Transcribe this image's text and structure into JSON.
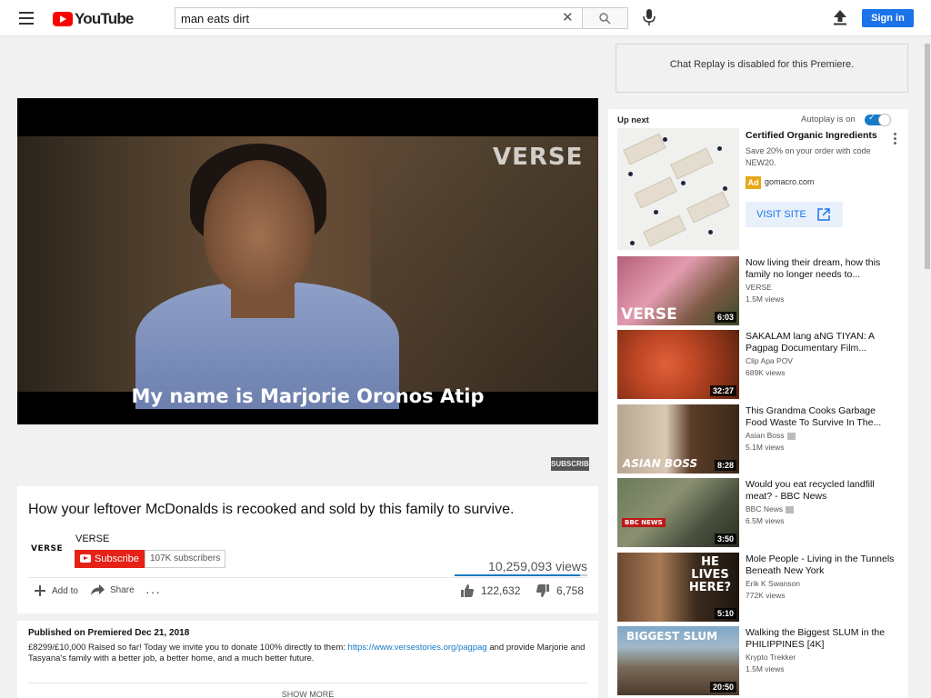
{
  "header": {
    "logo_text": "YouTube",
    "search_value": "man eats dirt",
    "clear_symbol": "✕",
    "signin_label": "Sign in",
    "icons": [
      "menu-icon",
      "search-icon",
      "mic-icon",
      "upload-icon"
    ]
  },
  "chat": {
    "message": "Chat Replay is disabled for this Premiere."
  },
  "player": {
    "watermark": "VERSE",
    "caption": "My name is Marjorie Oronos Atip",
    "subscribe_tag": "SUBSCRIBE"
  },
  "video_info": {
    "title": "How your leftover McDonalds is recooked and sold by this family to survive.",
    "channel_logo": "VERSE",
    "channel_name": "VERSE",
    "subscribe_label": "Subscribe",
    "subscriber_count": "107K subscribers",
    "views": "10,259,093 views",
    "like_ratio": 0.948,
    "add_to_label": "Add to",
    "share_label": "Share",
    "likes": "122,632",
    "dislikes": "6,758"
  },
  "description": {
    "published": "Published on Premiered Dec 21, 2018",
    "text_before": "£8299/£10,000 Raised so far! Today we invite you to donate 100% directly to them: ",
    "link": "https://www.versestories.org/pagpag",
    "text_after": " and provide Marjorie and Tasyana's family with a better job, a better home, and a much better future.",
    "show_more": "SHOW MORE"
  },
  "sidebar": {
    "up_next": "Up next",
    "autoplay_label": "Autoplay is on",
    "autoplay_on": true,
    "ad": {
      "title": "Certified Organic Ingredients",
      "description": "Save 20% on your order with code NEW20.",
      "badge": "Ad",
      "domain": "gomacro.com",
      "visit_label": "VISIT SITE"
    },
    "videos": [
      {
        "title": "Now living their dream, how this family no longer needs to...",
        "channel": "VERSE",
        "views": "1.5M views",
        "duration": "6:03",
        "thumb_text": "VERSE"
      },
      {
        "title": "SAKALAM lang aNG TIYAN: A Pagpag Documentary Film...",
        "channel": "Clip Apa POV",
        "views": "689K views",
        "duration": "32:27",
        "thumb_text": ""
      },
      {
        "title": "This Grandma Cooks Garbage Food Waste To Survive In The...",
        "channel": "Asian Boss",
        "views": "5.1M views",
        "duration": "8:28",
        "thumb_text": "ASIAN BOSS"
      },
      {
        "title": "Would you eat recycled landfill meat? - BBC News",
        "channel": "BBC News",
        "views": "6.5M views",
        "duration": "3:50",
        "thumb_text": "BBC NEWS"
      },
      {
        "title": "Mole People - Living in the Tunnels Beneath New York",
        "channel": "Erik K Swanson",
        "views": "772K views",
        "duration": "5:10",
        "thumb_text": "HE LIVES HERE?"
      },
      {
        "title": "Walking the Biggest SLUM in the PHILIPPINES [4K]",
        "channel": "Krypto Trekker",
        "views": "1.5M views",
        "duration": "20:50",
        "thumb_text": "BIGGEST SLUM"
      }
    ]
  },
  "colors": {
    "brand_red": "#ff0000",
    "subscribe_red": "#e62117",
    "link_blue": "#167ac6",
    "signin_blue": "#1a73e8",
    "ad_badge": "#e6a817"
  }
}
